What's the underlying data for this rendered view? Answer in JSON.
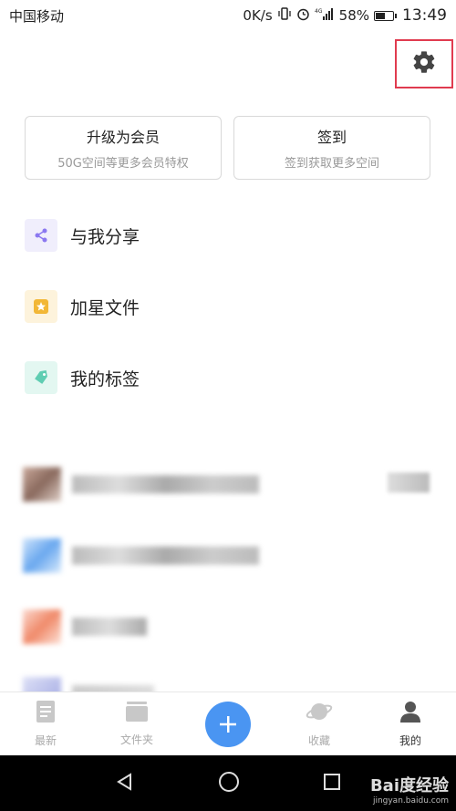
{
  "status_bar": {
    "carrier": "中国移动",
    "speed": "0K/s",
    "battery_percent": "58%",
    "battery_level": 0.58,
    "time": "13:49",
    "icons": [
      "vibrate-icon",
      "alarm-icon",
      "signal-4g-icon",
      "battery-icon"
    ]
  },
  "header": {
    "settings_icon": "gear-icon",
    "highlight_color": "#e03b4f"
  },
  "cards": {
    "upgrade": {
      "title": "升级为会员",
      "subtitle": "50G空间等更多会员特权"
    },
    "checkin": {
      "title": "签到",
      "subtitle": "签到获取更多空间"
    }
  },
  "menu": {
    "items": [
      {
        "label": "与我分享",
        "icon": "share-icon",
        "color": "#8b78f0",
        "bg": "#f0eefc"
      },
      {
        "label": "加星文件",
        "icon": "star-icon",
        "color": "#f2b736",
        "bg": "#fdf3dc"
      },
      {
        "label": "我的标签",
        "icon": "tag-icon",
        "color": "#5fcdb2",
        "bg": "#e3f7f1"
      }
    ]
  },
  "tab_bar": {
    "tabs": [
      {
        "label": "最新",
        "icon": "document-icon"
      },
      {
        "label": "文件夹",
        "icon": "folder-icon"
      },
      {
        "label": "",
        "icon": "plus-icon"
      },
      {
        "label": "收藏",
        "icon": "planet-icon"
      },
      {
        "label": "我的",
        "icon": "user-icon"
      }
    ],
    "active_index": 4,
    "accent_color": "#4a95f2"
  },
  "nav_bar": {
    "icons": [
      "back-triangle-icon",
      "home-circle-icon",
      "recents-square-icon"
    ]
  },
  "watermark": {
    "logo": "Bai度经验",
    "url": "jingyan.baidu.com"
  }
}
